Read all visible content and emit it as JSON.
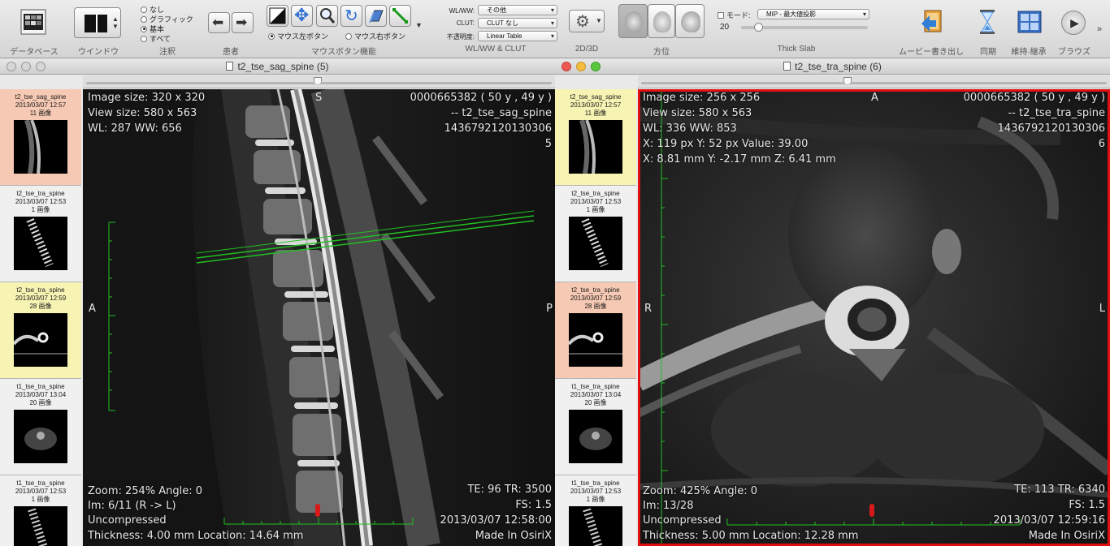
{
  "toolbar": {
    "database_label": "データベース",
    "window_label": "ウインドウ",
    "annotation_label": "注釈",
    "annotation_options": [
      "なし",
      "グラフィック",
      "基本",
      "すべて"
    ],
    "annotation_selected": "基本",
    "patient_label": "患者",
    "mouse_label": "マウスボタン機能",
    "mouse_left_label": "マウス左ボタン",
    "mouse_right_label": "マウス右ボタン",
    "wlww_group_label": "WL/WW & CLUT",
    "wlww_label": "WL/WW:",
    "wlww_value": "その他",
    "clut_label": "CLUT:",
    "clut_value": "CLUT なし",
    "opacity_label": "不透明度:",
    "opacity_value": "Linear Table",
    "twod3d_label": "2D/3D",
    "orientation_label": "方位",
    "mode_label": "モード:",
    "mode_value": "MIP - 最大値投影",
    "slab_value": "20",
    "thickslab_label": "Thick Slab",
    "movie_label": "ムービー書き出し",
    "sync_label": "同期",
    "tile_label": "維持·継承",
    "browse_label": "ブラウズ"
  },
  "left_window": {
    "title": "t2_tse_sag_spine (5)",
    "overlay": {
      "image_size": "Image size: 320 x 320",
      "view_size": "View size: 580 x 563",
      "wl_ww": "WL: 287 WW: 656",
      "patient_id": "0000665382 (  50 y , 49 y )",
      "series_name": "-- t2_tse_sag_spine",
      "study_id": "1436792120130306",
      "series_num": "5",
      "zoom": "Zoom: 254% Angle: 0",
      "im": "Im: 6/11  (R -> L)",
      "compression": "Uncompressed",
      "thickness": "Thickness: 4.00 mm Location: 14.64 mm",
      "te_tr": "TE:  96 TR:  3500",
      "fs": "FS:  1.5",
      "datetime": "2013/03/07 12:58:00",
      "made_in": "Made In OsiriX"
    },
    "orient": {
      "top": "S",
      "left": "A",
      "right": "P"
    }
  },
  "right_window": {
    "title": "t2_tse_tra_spine (6)",
    "overlay": {
      "image_size": "Image size: 256 x 256",
      "view_size": "View size: 580 x 563",
      "wl_ww": "WL: 336 WW: 853",
      "pixel": "X: 119 px Y: 52 px Value: 39.00",
      "mm": "X: 8.81 mm Y: -2.17 mm Z: 6.41 mm",
      "patient_id": "0000665382 (  50 y , 49 y )",
      "series_name": "-- t2_tse_tra_spine",
      "study_id": "1436792120130306",
      "series_num": "6",
      "zoom": "Zoom: 425% Angle: 0",
      "im": "Im: 13/28",
      "compression": "Uncompressed",
      "thickness": "Thickness: 5.00 mm Location: 12.28 mm",
      "te_tr": "TE:  113 TR:  6340",
      "fs": "FS:  1.5",
      "datetime": "2013/03/07 12:59:16",
      "made_in": "Made In OsiriX"
    },
    "orient": {
      "top": "A",
      "left": "R",
      "right": "L"
    }
  },
  "series": [
    {
      "name": "t2_tse_sag_spine",
      "date": "2013/03/07 12:57",
      "count": "11 画像"
    },
    {
      "name": "t2_tse_tra_spine",
      "date": "2013/03/07 12:53",
      "count": "1 画像"
    },
    {
      "name": "t2_tse_tra_spine",
      "date": "2013/03/07 12:59",
      "count": "28 画像"
    },
    {
      "name": "t1_tse_tra_spine",
      "date": "2013/03/07 13:04",
      "count": "20 画像"
    },
    {
      "name": "t1_tse_tra_spine",
      "date": "2013/03/07 12:53",
      "count": "1 画像"
    }
  ],
  "colors": {
    "active_frame": "#e01010",
    "selected_thumb": "#f6c9b4",
    "current_thumb": "#f7f3b3",
    "reference_lines": "#22c022"
  }
}
